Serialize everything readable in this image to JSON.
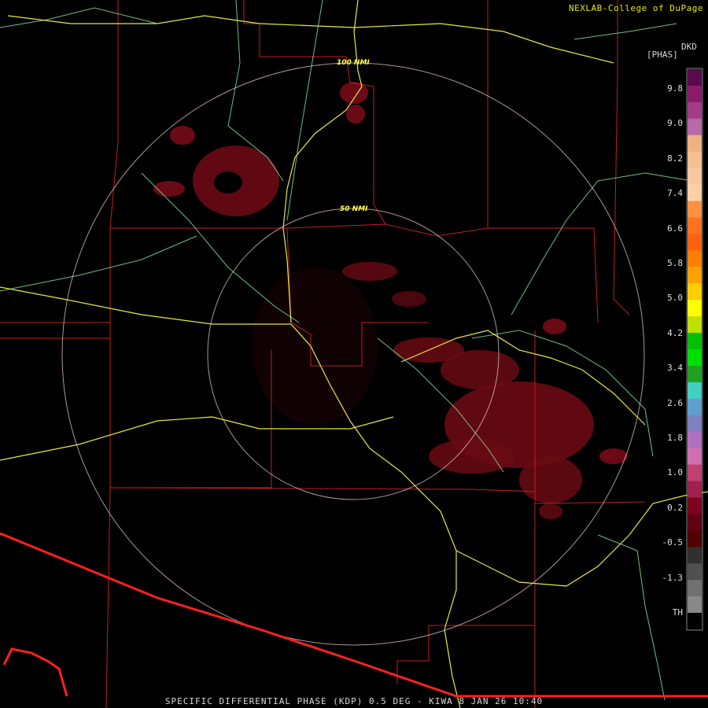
{
  "header": {
    "credit": "NEXLAB-College of DuPage"
  },
  "footer": {
    "caption": "SPECIFIC DIFFERENTIAL PHASE (KDP) 0.5 DEG - KIWA 8 JAN 26 10:40"
  },
  "range_rings": [
    {
      "label": "100 NMI"
    },
    {
      "label": "50 NMI"
    }
  ],
  "legend": {
    "unit_top": "DKD",
    "unit_sub": "[PHAS]",
    "ticks": [
      "9.8",
      "9.0",
      "8.2",
      "7.4",
      "6.6",
      "5.8",
      "5.0",
      "4.2",
      "3.4",
      "2.6",
      "1.8",
      "1.0",
      "0.2",
      "-0.5",
      "-1.3",
      "TH"
    ],
    "colors": [
      "#5a0a4a",
      "#8a1a6a",
      "#a33c88",
      "#b86aa6",
      "#f0b080",
      "#f6c090",
      "#f8c8a0",
      "#ffd0a8",
      "#ff9040",
      "#ff7020",
      "#ff6010",
      "#ff8000",
      "#ffa000",
      "#ffcc00",
      "#ffff00",
      "#c0e000",
      "#00c000",
      "#00e000",
      "#20a020",
      "#40d0c0",
      "#60a0d0",
      "#8080c0",
      "#b070c0",
      "#d070b0",
      "#c04070",
      "#a02050",
      "#800020",
      "#600010",
      "#500000",
      "#303030",
      "#505050",
      "#707070",
      "#888888",
      "#000000"
    ]
  },
  "colors": {
    "echo": "#6a0a14",
    "state_border": "#cc2222",
    "county_border": "#c02020",
    "highway": "#e8e840",
    "river": "#80e0a0",
    "ring": "#e8c8c8",
    "intl_border": "#ff2020"
  }
}
